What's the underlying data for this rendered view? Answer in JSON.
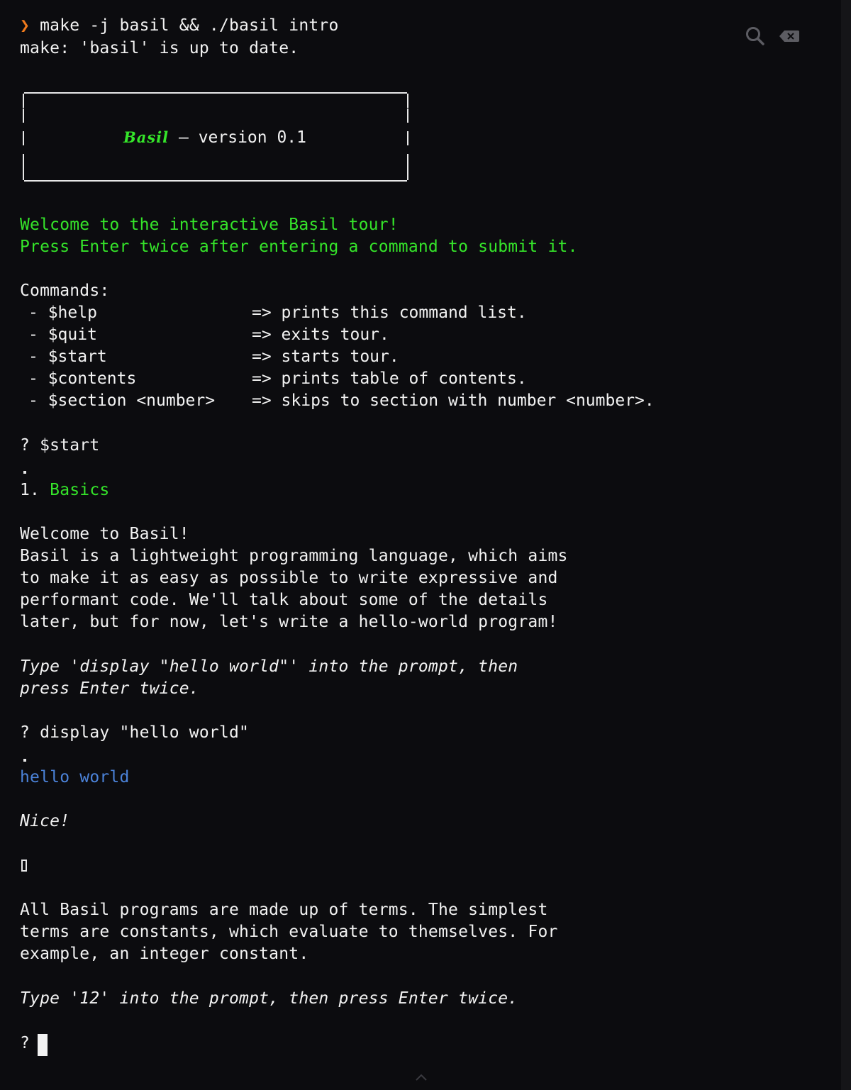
{
  "terminal": {
    "prompt_symbol": "❯",
    "command": " make -j basil && ./basil intro",
    "make_output": "make: 'basil' is up to date.",
    "banner": {
      "logo_text": "Basil",
      "separator": " – ",
      "version_text": "version 0.1"
    },
    "welcome_line_1": "Welcome to the interactive Basil tour!",
    "welcome_line_2": "Press Enter twice after entering a command to submit it.",
    "commands_header": "Commands:",
    "commands": [
      {
        "name": "- $help",
        "desc": "=> prints this command list."
      },
      {
        "name": "- $quit",
        "desc": "=> exits tour."
      },
      {
        "name": "- $start",
        "desc": "=> starts tour."
      },
      {
        "name": "- $contents",
        "desc": "=> prints table of contents."
      },
      {
        "name": "- $section <number>",
        "desc": "=> skips to section with number <number>."
      }
    ],
    "prompt_start": "? $start",
    "section_number": "1. ",
    "section_title": "Basics",
    "intro_paragraph": [
      "Welcome to Basil!",
      "Basil is a lightweight programming language, which aims",
      "to make it as easy as possible to write expressive and",
      "performant code. We'll talk about some of the details",
      "later, but for now, let's write a hello-world program!"
    ],
    "instruction_1": [
      "Type 'display \"hello world\"' into the prompt, then",
      "press Enter twice."
    ],
    "prompt_display": "? display \"hello world\"",
    "output_hello": "hello world",
    "nice": "Nice!",
    "terms_paragraph": [
      "All Basil programs are made up of terms. The simplest",
      "terms are constants, which evaluate to themselves. For",
      "example, an integer constant."
    ],
    "instruction_2": "Type '12' into the prompt, then press Enter twice.",
    "current_prompt": "? "
  },
  "icons": {
    "search": "search-icon",
    "clear": "backspace-icon",
    "scroll": "chevron-up-icon"
  },
  "colors": {
    "background": "#0c0c0f",
    "text": "#f2f2f2",
    "green": "#35e52a",
    "blue": "#4b82d8",
    "orange": "#f07a1c"
  }
}
